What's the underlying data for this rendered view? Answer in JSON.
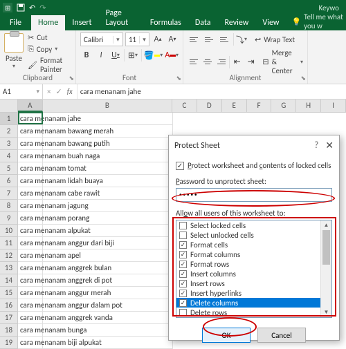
{
  "title_doc": "Keywo",
  "tabs": {
    "file": "File",
    "home": "Home",
    "insert": "Insert",
    "pagelayout": "Page Layout",
    "formulas": "Formulas",
    "data": "Data",
    "review": "Review",
    "view": "View",
    "tellme": "Tell me what you w"
  },
  "clipboard": {
    "paste": "Paste",
    "cut": "Cut",
    "copy": "Copy",
    "painter": "Format Painter",
    "group": "Clipboard"
  },
  "font": {
    "name": "Calibri",
    "size": "11",
    "group": "Font",
    "B": "B",
    "I": "I",
    "U": "U"
  },
  "alignment": {
    "wrap": "Wrap Text",
    "merge": "Merge & Center",
    "group": "Alignment"
  },
  "namebox": "A1",
  "formula_value": "cara menanam jahe",
  "cols": [
    "A",
    "B",
    "C",
    "D",
    "E",
    "F",
    "G",
    "H",
    "I"
  ],
  "rows": [
    "cara menanam jahe",
    "cara menanam bawang merah",
    "cara menanam bawang putih",
    "cara menanam buah naga",
    "cara menanam tomat",
    "cara menanam lidah buaya",
    "cara menanam cabe rawit",
    "cara menanam jagung",
    "cara menanam porang",
    "cara menanam alpukat",
    "cara menanam anggur dari biji",
    "cara menanam apel",
    "cara menanam anggrek bulan",
    "cara menanam anggrek di pot",
    "cara menanam anggur merah",
    "cara menanam anggur dalam pot",
    "cara menanam anggrek vanda",
    "cara menanam bunga",
    "cara menanam biji alpukat"
  ],
  "dialog": {
    "title": "Protect Sheet",
    "protect_label": "Protect worksheet and contents of locked cells",
    "pwd_label": "Password to unprotect sheet:",
    "pwd_mask": "•••••",
    "allow_label": "Allow all users of this worksheet to:",
    "items": [
      {
        "label": "Select locked cells",
        "checked": false
      },
      {
        "label": "Select unlocked cells",
        "checked": false
      },
      {
        "label": "Format cells",
        "checked": true
      },
      {
        "label": "Format columns",
        "checked": true
      },
      {
        "label": "Format rows",
        "checked": true
      },
      {
        "label": "Insert columns",
        "checked": true
      },
      {
        "label": "Insert rows",
        "checked": true
      },
      {
        "label": "Insert hyperlinks",
        "checked": true
      },
      {
        "label": "Delete columns",
        "checked": true,
        "selected": true
      },
      {
        "label": "Delete rows",
        "checked": false
      }
    ],
    "ok": "OK",
    "cancel": "Cancel"
  }
}
